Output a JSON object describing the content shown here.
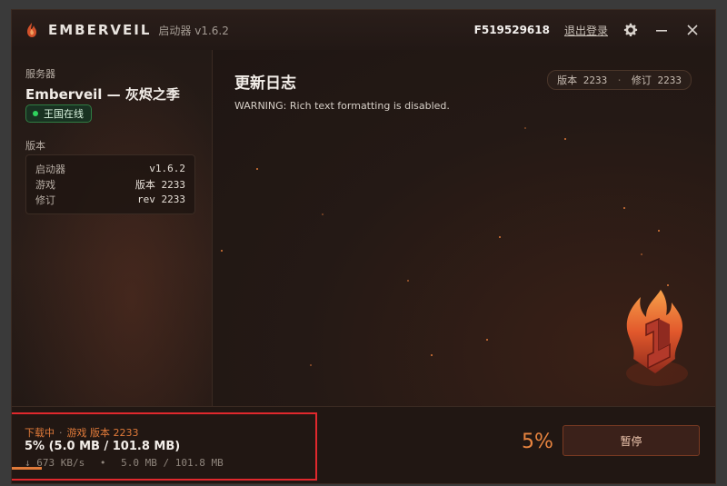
{
  "header": {
    "app_name": "EMBERVEIL",
    "subtitle": "启动器  v1.6.2",
    "account_id": "F519529618",
    "logout_label": "退出登录"
  },
  "sidebar": {
    "server_label": "服务器",
    "server_name": "Emberveil — 灰烬之季",
    "status_text": "王国在线",
    "version_label": "版本",
    "versions": [
      {
        "key": "启动器",
        "value": "v1.6.2"
      },
      {
        "key": "游戏",
        "value": "版本 2233"
      },
      {
        "key": "修订",
        "value": "rev 2233"
      }
    ]
  },
  "main": {
    "title": "更新日志",
    "warning": "WARNING: Rich text formatting is disabled.",
    "version_chip_a": "版本 2233",
    "version_chip_b": "修订 2233"
  },
  "footer": {
    "status_a": "下载中",
    "status_b": "游戏 版本 2233",
    "progress_text": "5% (5.0 MB / 101.8 MB)",
    "speed": "673 KB/s",
    "transferred": "5.0 MB / 101.8 MB",
    "percent_label": "5%",
    "progress_fraction": 0.05,
    "pause_label": "暂停"
  },
  "colors": {
    "accent": "#e07a3a",
    "online": "#2fd35e",
    "highlight_box": "#e0282d"
  },
  "icons": {
    "brand": "ember-flame-icon",
    "settings": "gear-icon",
    "minimize": "minimize-icon",
    "close": "close-icon",
    "download": "download-arrow-icon"
  }
}
